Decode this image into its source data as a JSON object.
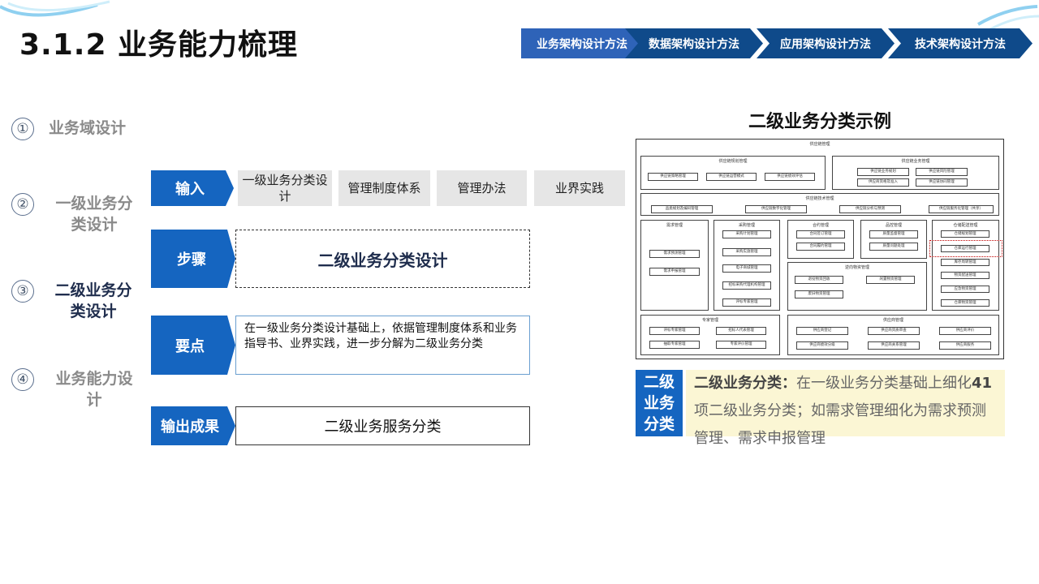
{
  "header": {
    "title": "3.1.2 业务能力梳理",
    "breadcrumbs": [
      "业务架构设计方法",
      "数据架构设计方法",
      "应用架构设计方法",
      "技术架构设计方法"
    ],
    "active_color": "#2e63b8",
    "inactive_color": "#0f4a8a"
  },
  "steps": [
    {
      "num": "①",
      "label": "业务域设计"
    },
    {
      "num": "②",
      "label": "一级业务分类设计"
    },
    {
      "num": "③",
      "label": "二级业务分类设计"
    },
    {
      "num": "④",
      "label": "业务能力设计"
    }
  ],
  "process": {
    "input_tag": "输入",
    "inputs": [
      "一级业务分类设计",
      "管理制度体系",
      "管理办法",
      "业界实践"
    ],
    "step_tag": "步骤",
    "step_text": "二级业务分类设计",
    "key_tag": "要点",
    "key_text": "在一级业务分类设计基础上，依据管理制度体系和业务指导书、业界实践，进一步分解为二级业务分类",
    "output_tag": "输出成果",
    "output_text": "二级业务服务分类",
    "tag_color": "#1565c0"
  },
  "example": {
    "title": "二级业务分类示例",
    "diagram": {
      "root": "供应链管理",
      "groups": [
        {
          "name": "供应链规划管理",
          "items": [
            "供应链策略管理",
            "供应链运营模式",
            "供应链绩效评估"
          ]
        },
        {
          "name": "供应链业务管理",
          "items": [
            "供应链业务规划",
            "供应链风险管理",
            "供应商资格及准入",
            "供应链协同管理"
          ]
        },
        {
          "name": "供应链技术管理",
          "items": [
            "品类规划及编码管理",
            "供应链数字化管理",
            "供应链分析与预测",
            "供应链服务化管理（共享）"
          ]
        },
        {
          "name": "需求管理",
          "items": [
            "需求预测管理",
            "需求申报管理"
          ]
        },
        {
          "name": "采购管理",
          "items": [
            "采购计划管理",
            "采购实施管理",
            "电子商城管理",
            "招标采购代理机构管理",
            "评标专家管理"
          ]
        },
        {
          "name": "合约管理",
          "items": [
            "合同签订管理",
            "合同履约管理"
          ]
        },
        {
          "name": "品控管理",
          "items": [
            "质量监督管理",
            "质量问题处理"
          ]
        },
        {
          "name": "仓储配送管理",
          "items": [
            "仓储规划管理",
            "仓库运行管理",
            "库存周转管理",
            "物资配送管理",
            "应急物资管理",
            "仓库物资管理"
          ]
        },
        {
          "name": "逆向物资管理",
          "items": [
            "退役物资回收",
            "闲置物资管理",
            "废旧物资管理"
          ]
        },
        {
          "name": "专家管理",
          "items": [
            "评标专家管理",
            "招标人代表管理",
            "抽取专家管理",
            "专家评价管理"
          ]
        },
        {
          "name": "供应商管理",
          "items": [
            "供应商登记",
            "供应商资质审查",
            "供应商评价",
            "供应商绩效分级",
            "供应商关系管理",
            "供应商服务"
          ]
        }
      ]
    },
    "badge": "二级业务分类",
    "desc_bold": "二级业务分类：",
    "desc_text": "在一级业务分类基础上细化",
    "desc_count": "41",
    "desc_rest": "项二级业务分类；如需求管理细化为需求预测管理、需求申报管理",
    "badge_color": "#1565c0",
    "desc_bg": "#fbf6d4",
    "highlight_color": "#c00000"
  }
}
